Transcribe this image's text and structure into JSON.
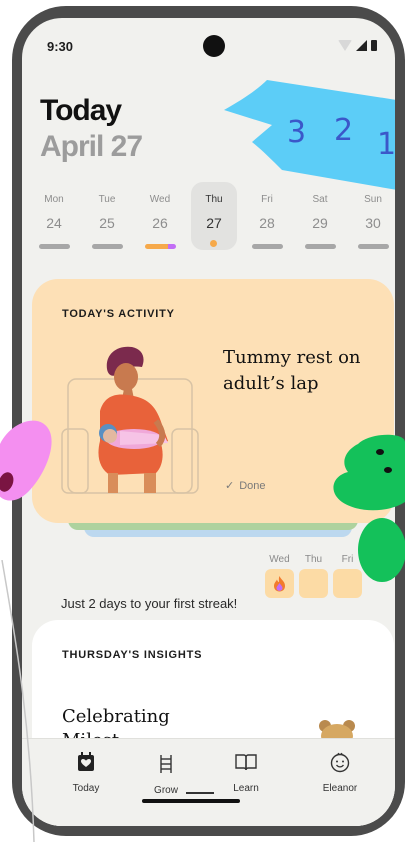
{
  "status_bar": {
    "time": "9:30"
  },
  "header": {
    "title": "Today",
    "date": "April 27"
  },
  "flag_numbers": [
    "3",
    "2",
    "1"
  ],
  "week": [
    {
      "day": "Mon",
      "date": "24"
    },
    {
      "day": "Tue",
      "date": "25"
    },
    {
      "day": "Wed",
      "date": "26"
    },
    {
      "day": "Thu",
      "date": "27",
      "selected": true
    },
    {
      "day": "Fri",
      "date": "28"
    },
    {
      "day": "Sat",
      "date": "29"
    },
    {
      "day": "Sun",
      "date": "30"
    }
  ],
  "activity": {
    "heading": "TODAY'S ACTIVITY",
    "title": "Tummy rest on adult’s lap",
    "status": "Done"
  },
  "streak": {
    "text": "Just 2 days to your first streak!",
    "days": [
      {
        "label": "Wed",
        "filled": true
      },
      {
        "label": "Thu",
        "filled": false
      },
      {
        "label": "Fri",
        "filled": false
      }
    ]
  },
  "insights": {
    "heading": "THURSDAY'S INSIGHTS",
    "title_line1": "Celebrating",
    "title_line2": "Milest"
  },
  "tabs": [
    {
      "label": "Today",
      "icon": "calendar-heart-icon"
    },
    {
      "label": "Grow",
      "icon": "ladder-icon"
    },
    {
      "label": "Learn",
      "icon": "book-icon"
    },
    {
      "label": "Eleanor",
      "icon": "smiley-icon"
    }
  ],
  "colors": {
    "background": "#f1f1ee",
    "activity_card": "#fde0b6",
    "flag": "#5ccdf7",
    "accent_orange": "#f6a94a",
    "accent_purple": "#c26ef5",
    "green_blob": "#14c15a",
    "pink_blob": "#f48ff0"
  }
}
